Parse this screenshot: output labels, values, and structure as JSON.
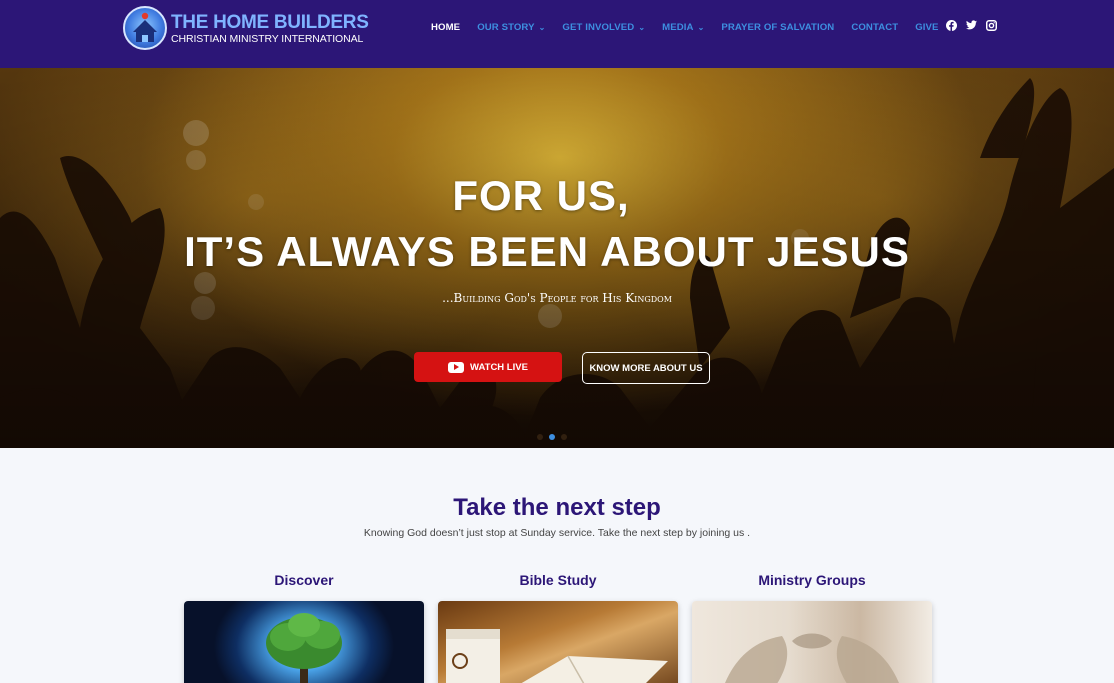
{
  "brand": {
    "title": "THE HOME BUILDERS",
    "subtitle": "CHRISTIAN MINISTRY INTERNATIONAL",
    "colors": {
      "header_bg": "#2c1677",
      "nav_link": "#3d8fe0",
      "accent_red": "#d51212"
    }
  },
  "nav": {
    "items": [
      {
        "label": "HOME",
        "active": true,
        "has_dropdown": false
      },
      {
        "label": "OUR STORY",
        "active": false,
        "has_dropdown": true
      },
      {
        "label": "GET INVOLVED",
        "active": false,
        "has_dropdown": true
      },
      {
        "label": "MEDIA",
        "active": false,
        "has_dropdown": true
      },
      {
        "label": "PRAYER OF SALVATION",
        "active": false,
        "has_dropdown": false
      },
      {
        "label": "CONTACT",
        "active": false,
        "has_dropdown": false
      },
      {
        "label": "GIVE",
        "active": false,
        "has_dropdown": false
      }
    ],
    "social_icons": [
      "facebook-icon",
      "twitter-icon",
      "instagram-icon"
    ]
  },
  "hero": {
    "headline_line1": "FOR US,",
    "headline_line2": "IT’S ALWAYS BEEN ABOUT JESUS",
    "tagline": "...Building God's People for His Kingdom",
    "watch_live_label": "WATCH LIVE",
    "know_more_label": "KNOW MORE ABOUT US",
    "slides_count": 3,
    "active_slide": 2
  },
  "next_step": {
    "title": "Take the next step",
    "subtitle": "Knowing God doesn’t just stop at Sunday service. Take the next step by joining us .",
    "cards": [
      {
        "title": "Discover"
      },
      {
        "title": "Bible Study"
      },
      {
        "title": "Ministry Groups"
      }
    ]
  }
}
